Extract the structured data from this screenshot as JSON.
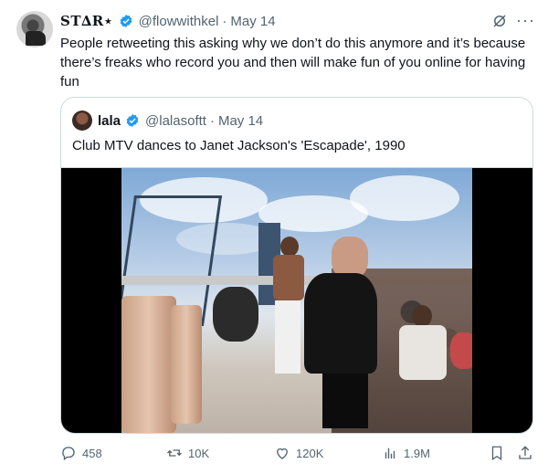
{
  "tweet": {
    "name": "ST∆R⋆",
    "handle": "@flowwithkel",
    "separator": "·",
    "date": "May 14",
    "more": "···",
    "text": "People retweeting this asking why we don’t do this anymore and it’s because there’s freaks who record you and then will make fun of you online for having fun"
  },
  "quote": {
    "name": "lala",
    "handle": "@lalasoftt",
    "separator": "·",
    "date": "May 14",
    "text": "Club MTV dances to Janet Jackson's 'Escapade', 1990"
  },
  "actions": {
    "replies": "458",
    "reposts": "10K",
    "likes": "120K",
    "views": "1.9M"
  },
  "colors": {
    "verified": "#1d9bf0",
    "muted": "#536471",
    "border": "#cfd9de"
  }
}
